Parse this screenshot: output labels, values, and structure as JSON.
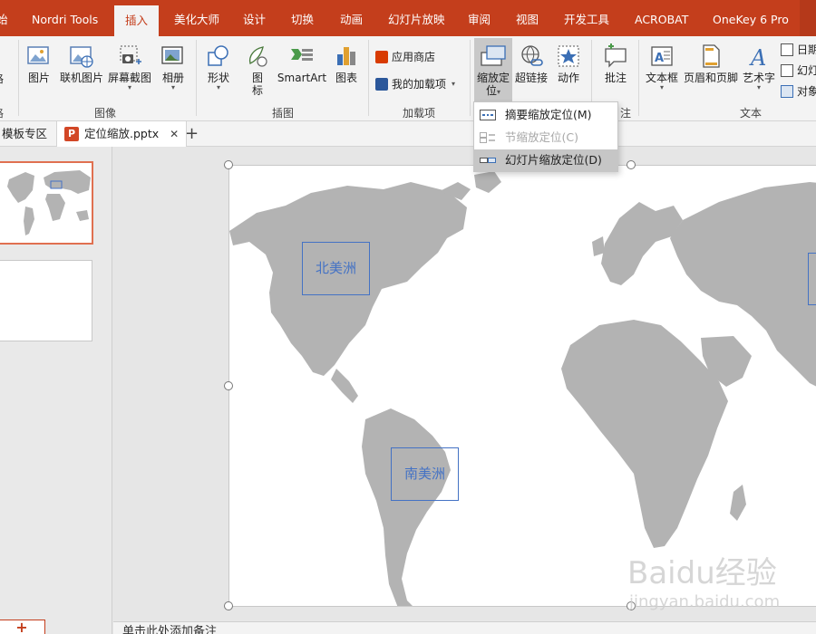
{
  "ribbon_tabs": [
    {
      "label": "始"
    },
    {
      "label": "Nordri Tools"
    },
    {
      "label": "插入",
      "active": true
    },
    {
      "label": "美化大师"
    },
    {
      "label": "设计"
    },
    {
      "label": "切换"
    },
    {
      "label": "动画"
    },
    {
      "label": "幻灯片放映"
    },
    {
      "label": "审阅"
    },
    {
      "label": "视图"
    },
    {
      "label": "开发工具"
    },
    {
      "label": "ACROBAT"
    },
    {
      "label": "OneKey 6 Pro"
    }
  ],
  "ribbon": {
    "partial_left_button": "格",
    "partial_left_group": "格",
    "image_group": {
      "label": "图像",
      "buttons": [
        "图片",
        "联机图片",
        "屏幕截图",
        "相册"
      ]
    },
    "illustration_group": {
      "label": "插图",
      "buttons": [
        "形状",
        "图标",
        "SmartArt",
        "图表"
      ]
    },
    "addins_group": {
      "label": "加载项",
      "store": "应用商店",
      "my_addins": "我的加载项"
    },
    "links_group": {
      "zoom_button": "缩放定位",
      "zoom_button_line1": "缩放定",
      "zoom_button_line2": "位",
      "hyperlink": "超链接",
      "action": "动作"
    },
    "comments_group": {
      "comment": "批注",
      "label_partial": "注"
    },
    "text_group": {
      "label": "文本",
      "textbox": "文本框",
      "header_footer": "页眉和页脚",
      "wordart": "艺术字",
      "date": "日期",
      "slide_number": "幻灯",
      "object": "对象"
    }
  },
  "zoom_menu": {
    "items": [
      {
        "label": "摘要缩放定位(M)",
        "state": "normal"
      },
      {
        "label": "节缩放定位(C)",
        "state": "disabled"
      },
      {
        "label": "幻灯片缩放定位(D)",
        "state": "hover"
      }
    ]
  },
  "doc_tabs": {
    "template_tab": "模板专区",
    "file_tab": "定位缩放.pptx",
    "close_glyph": "✕",
    "new_tab_glyph": "+"
  },
  "slide": {
    "zoom_boxes": [
      {
        "label": "北美洲"
      },
      {
        "label": "南美洲"
      }
    ],
    "map_fill": "#b3b3b3"
  },
  "thumbnails": {
    "add_slide": "+"
  },
  "notes_placeholder": "单击此处添加备注",
  "watermark": {
    "brand": "Baidu经验",
    "url": "jingyan.baidu.com"
  },
  "colors": {
    "accent": "#c43e1c",
    "zoom_box": "#4472c4"
  }
}
